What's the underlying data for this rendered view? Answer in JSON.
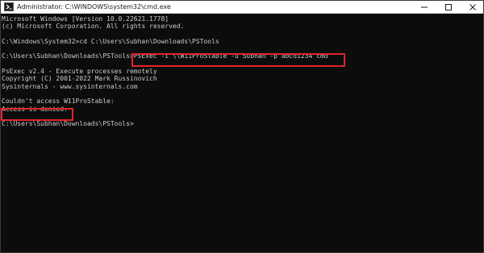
{
  "window": {
    "title": "Administrator: C:\\WINDOWS\\system32\\cmd.exe"
  },
  "controls": {
    "minimize": "minimize",
    "maximize": "maximize",
    "close": "close"
  },
  "console": {
    "lines": [
      "Microsoft Windows [Version 10.0.22621.1778]",
      "(c) Microsoft Corporation. All rights reserved.",
      "",
      "C:\\Windows\\System32>cd C:\\Users\\Subhan\\Downloads\\PSTools",
      "",
      "C:\\Users\\Subhan\\Downloads\\PSTools>PsExec -i \\\\W11ProStable -u Subhan -p abcd1234 cmd",
      "",
      "PsExec v2.4 - Execute processes remotely",
      "Copyright (C) 2001-2022 Mark Russinovich",
      "Sysinternals - www.sysinternals.com",
      "",
      "Couldn't access W11ProStable:",
      "Access is denied.",
      "",
      "C:\\Users\\Subhan\\Downloads\\PSTools>"
    ]
  },
  "colors": {
    "console_background": "#0c0c0c",
    "console_text": "#cccccc",
    "highlight_box": "#e0262a"
  }
}
